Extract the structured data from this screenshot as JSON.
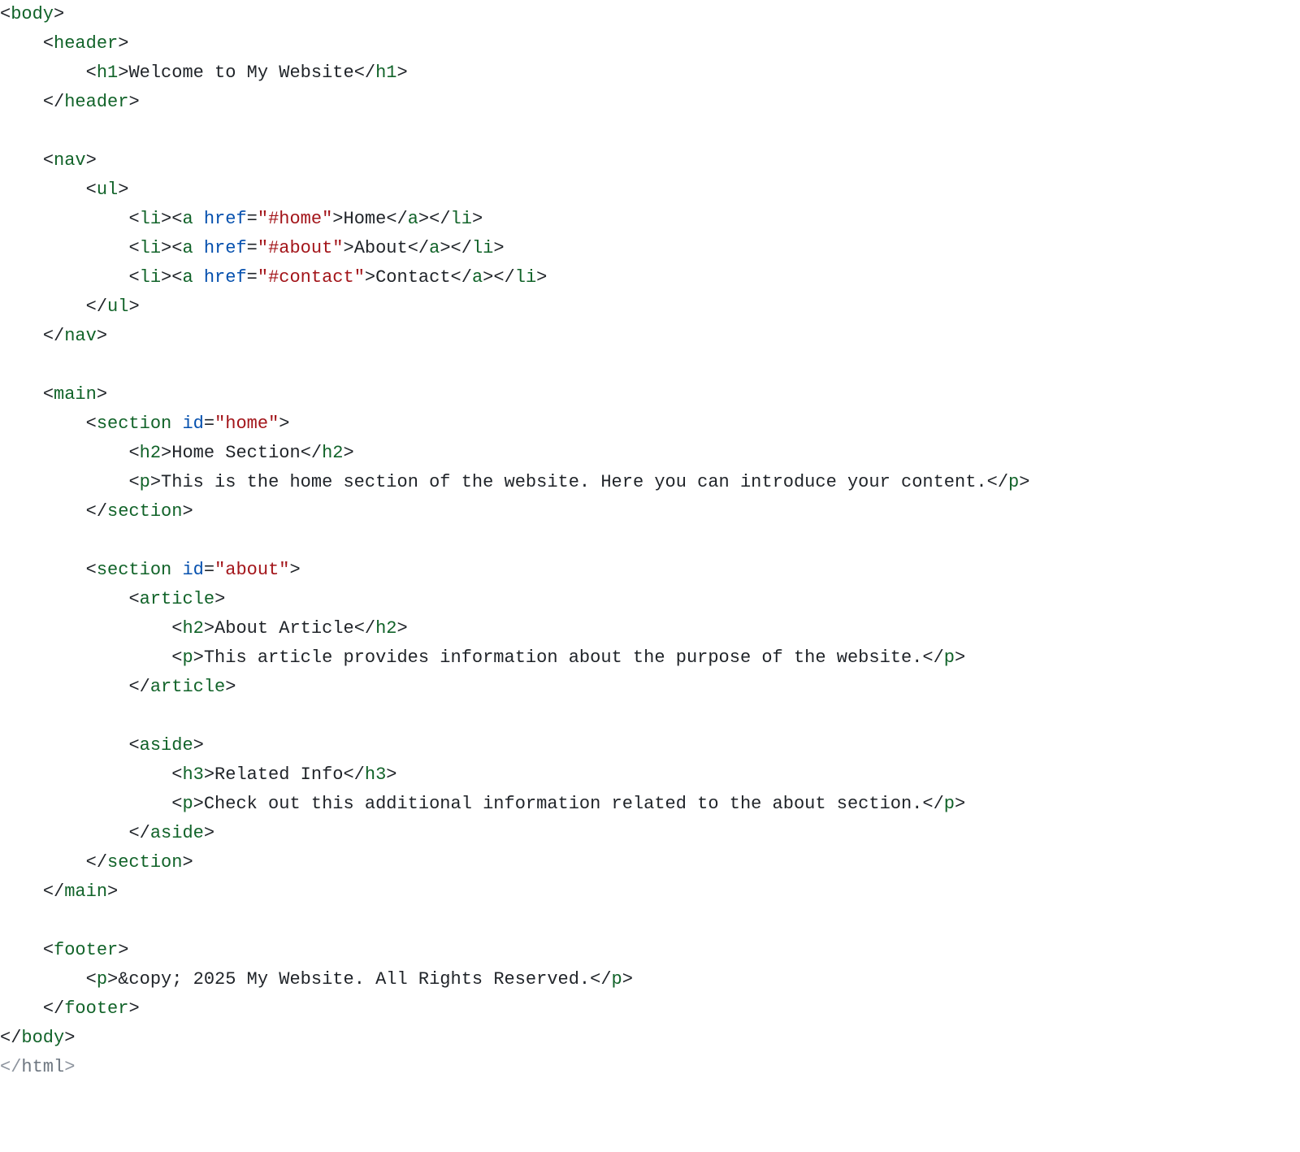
{
  "tags": {
    "body_open": "body",
    "body_close": "body",
    "header_open": "header",
    "header_close": "header",
    "h1_open": "h1",
    "h1_close": "h1",
    "nav_open": "nav",
    "nav_close": "nav",
    "ul_open": "ul",
    "ul_close": "ul",
    "li_open": "li",
    "li_close": "li",
    "a_open": "a",
    "a_close": "a",
    "main_open": "main",
    "main_close": "main",
    "section_open": "section",
    "section_close": "section",
    "h2_open": "h2",
    "h2_close": "h2",
    "p_open": "p",
    "p_close": "p",
    "article_open": "article",
    "article_close": "article",
    "aside_open": "aside",
    "aside_close": "aside",
    "h3_open": "h3",
    "h3_close": "h3",
    "footer_open": "footer",
    "footer_close": "footer",
    "html_close": "html"
  },
  "attrs": {
    "href": "href",
    "id": "id"
  },
  "strings": {
    "href_home": "\"#home\"",
    "href_about": "\"#about\"",
    "href_contact": "\"#contact\"",
    "id_home": "\"home\"",
    "id_about": "\"about\""
  },
  "text": {
    "h1": "Welcome to My Website",
    "nav_home": "Home",
    "nav_about": "About",
    "nav_contact": "Contact",
    "home_h2": "Home Section",
    "home_p": "This is the home section of the website. Here you can introduce your content.",
    "about_h2": "About Article",
    "about_p": "This article provides information about the purpose of the website.",
    "aside_h3": "Related Info",
    "aside_p": "Check out this additional information related to the about section.",
    "footer_entity": "&copy;",
    "footer_rest": " 2025 My Website. All Rights Reserved."
  }
}
